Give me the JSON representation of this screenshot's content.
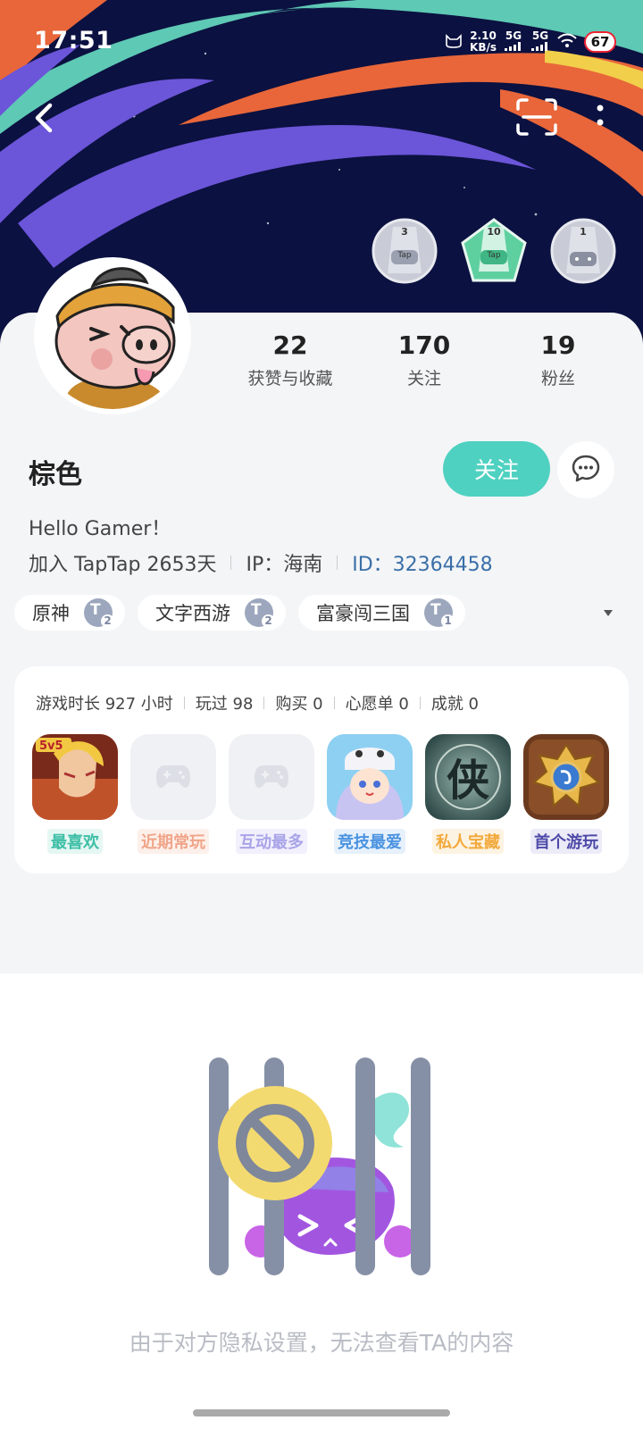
{
  "status_bar": {
    "time": "17:51",
    "net_speed_value": "2.10",
    "net_speed_unit": "KB/s",
    "sim1": "5G",
    "sim2": "5G",
    "battery": "67"
  },
  "header_icons": [
    "back-arrow-icon",
    "scan-icon",
    "more-vertical-icon"
  ],
  "badges": [
    {
      "number": "3",
      "label": "Tap",
      "color": "#c9ccd6"
    },
    {
      "number": "10",
      "label": "Tap",
      "color": "#5ed0a0"
    },
    {
      "number": "1",
      "label": "gamepad",
      "color": "#c9ccd6"
    }
  ],
  "profile": {
    "stats": [
      {
        "value": "22",
        "label": "获赞与收藏"
      },
      {
        "value": "170",
        "label": "关注"
      },
      {
        "value": "19",
        "label": "粉丝"
      }
    ],
    "name": "棕色",
    "follow_label": "关注",
    "bio": "Hello Gamer！",
    "joined": "加入 TapTap 2653天",
    "ip": "IP：海南",
    "id": "ID：32364458"
  },
  "tags": [
    {
      "label": "原神",
      "level": "2"
    },
    {
      "label": "文字西游",
      "level": "2"
    },
    {
      "label": "富豪闯三国",
      "level": "1"
    }
  ],
  "games_stats": [
    "游戏时长 927 小时",
    "玩过 98",
    "购买 0",
    "心愿单 0",
    "成就 0"
  ],
  "games": [
    {
      "label": "最喜欢",
      "color": "#3dbfa6",
      "bg": "#e5f7f3"
    },
    {
      "label": "近期常玩",
      "color": "#f0a58a",
      "bg": "#fdf0ea"
    },
    {
      "label": "互动最多",
      "color": "#a9a4e8",
      "bg": "#f1f0fc"
    },
    {
      "label": "竞技最爱",
      "color": "#4a93e0",
      "bg": "#e7f1fc"
    },
    {
      "label": "私人宝藏",
      "color": "#f2a93b",
      "bg": "#fdf3e2"
    },
    {
      "label": "首个游玩",
      "color": "#4e4aa8",
      "bg": "#ecebf8"
    }
  ],
  "privacy_message": "由于对方隐私设置，无法查看TA的内容",
  "colors": {
    "accent": "#4fd1c1",
    "id_link": "#3a6fa8",
    "banner_bg": "#0b1140"
  }
}
